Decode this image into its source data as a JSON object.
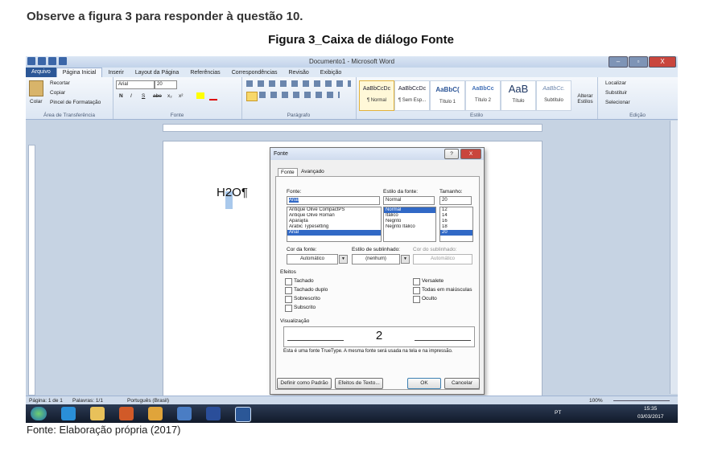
{
  "question": "Observe a figura 3 para responder à questão 10.",
  "figure_title": "Figura 3_Caixa de diálogo Fonte",
  "source": "Fonte: Elaboração própria (2017)",
  "word": {
    "window_title": "Documento1 - Microsoft Word",
    "window_buttons": [
      "–",
      "▫",
      "X"
    ],
    "tabs": [
      "Arquivo",
      "Página Inicial",
      "Inserir",
      "Layout da Página",
      "Referências",
      "Correspondências",
      "Revisão",
      "Exibição"
    ],
    "ribbon": {
      "clipboard": {
        "label": "Área de Transferência",
        "paste": "Colar",
        "cut": "Recortar",
        "copy": "Copiar",
        "format_painter": "Pincel de Formatação"
      },
      "font": {
        "label": "Fonte",
        "font_name": "Arial",
        "font_size": "20",
        "bold": "N",
        "italic": "I",
        "underline": "S",
        "strike": "abe",
        "subscript": "x₂",
        "superscript": "x²"
      },
      "paragraph": {
        "label": "Parágrafo"
      },
      "styles": {
        "label": "Estilo",
        "items": [
          {
            "preview": "AaBbCcDc",
            "name": "¶ Normal"
          },
          {
            "preview": "AaBbCcDc",
            "name": "¶ Sem Esp..."
          },
          {
            "preview": "AaBbC(",
            "name": "Título 1"
          },
          {
            "preview": "AaBbCc",
            "name": "Título 2"
          },
          {
            "preview": "AaB",
            "name": "Título"
          },
          {
            "preview": "AaBbCc.",
            "name": "Subtítulo"
          }
        ],
        "change_styles": "Alterar Estilos"
      },
      "editing": {
        "label": "Edição",
        "find": "Localizar",
        "replace": "Substituir",
        "select": "Selecionar"
      }
    },
    "document_text": "H2O¶",
    "status": {
      "page": "Página: 1 de 1",
      "words": "Palavras: 1/1",
      "language": "Português (Brasil)",
      "zoom": "100%"
    },
    "tray": {
      "lang": "PT",
      "time": "15:35",
      "date": "03/03/2017"
    }
  },
  "dialog": {
    "title": "Fonte",
    "help": "?",
    "close": "X",
    "tabs": [
      "Fonte",
      "Avançado"
    ],
    "font_label": "Fonte:",
    "font_value": "Arial",
    "font_list": [
      "Antique Olive CompactPS",
      "Antique Olive Roman",
      "Aparajita",
      "Arabic Typesetting",
      "Arial"
    ],
    "style_label": "Estilo da fonte:",
    "style_value": "Normal",
    "style_list": [
      "Normal",
      "Itálico",
      "Negrito",
      "Negrito Itálico"
    ],
    "size_label": "Tamanho:",
    "size_value": "20",
    "size_list": [
      "12",
      "14",
      "16",
      "18",
      "20"
    ],
    "color_label": "Cor da fonte:",
    "color_value": "Automático",
    "underline_label": "Estilo de sublinhado:",
    "underline_value": "(nenhum)",
    "underline_color_label": "Cor do sublinhado:",
    "underline_color_value": "Automático",
    "effects_label": "Efeitos",
    "effects_left": [
      "Tachado",
      "Tachado duplo",
      "Sobrescrito",
      "Subscrito"
    ],
    "effects_right": [
      "Versalete",
      "Todas em maiúsculas",
      "Oculto"
    ],
    "preview_label": "Visualização",
    "preview_text": "2",
    "note": "Esta é uma fonte TrueType. A mesma fonte será usada na tela e na impressão.",
    "buttons": {
      "default": "Definir como Padrão",
      "text_effects": "Efeitos de Texto...",
      "ok": "OK",
      "cancel": "Cancelar"
    }
  }
}
